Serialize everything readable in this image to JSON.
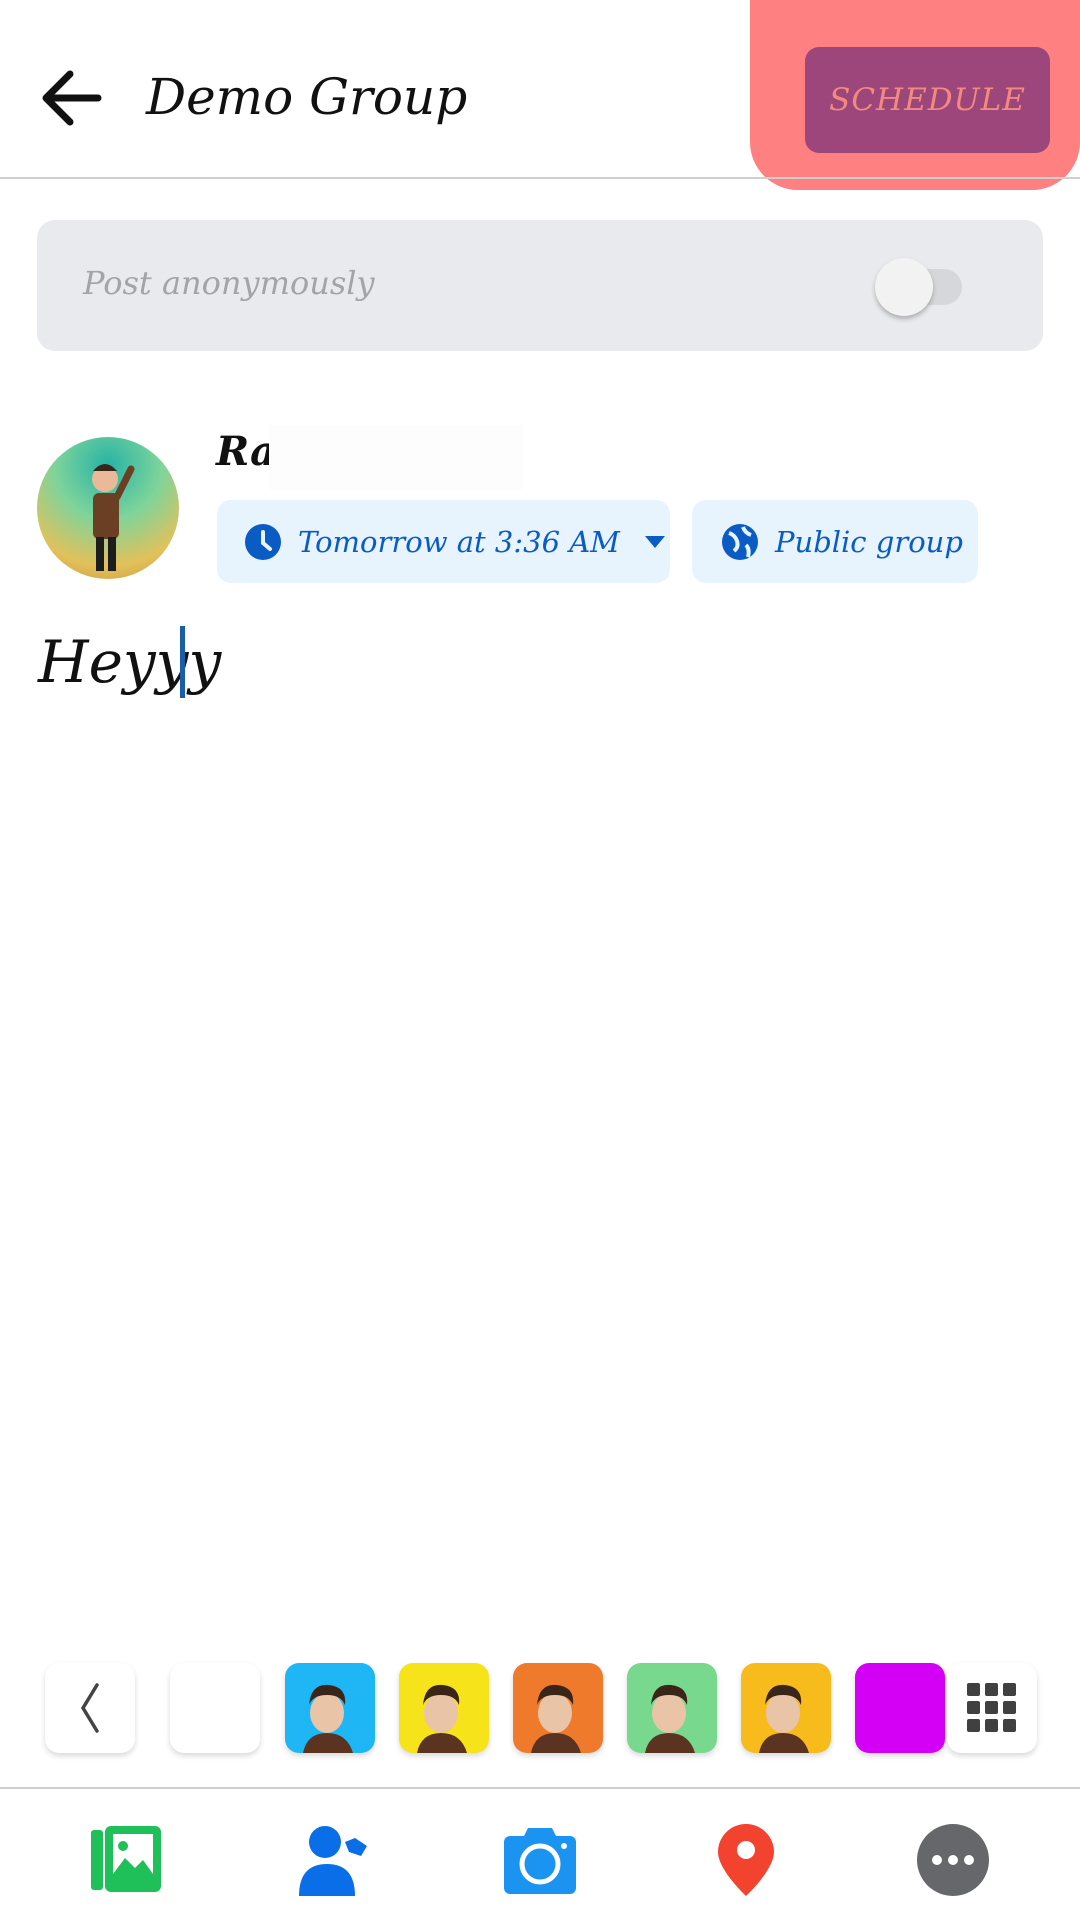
{
  "header": {
    "title": "Demo Group",
    "back_icon": "arrow-left-icon",
    "schedule_label": "SCHEDULE",
    "schedule_bg": "#9c467c",
    "schedule_text_color": "#f28a7e",
    "highlight_color": "#ff8080"
  },
  "anonymous": {
    "label": "Post anonymously",
    "enabled": false
  },
  "author": {
    "name": "Ra",
    "schedule_chip": {
      "label": "Tomorrow at 3:36 AM",
      "icon": "clock-icon",
      "dropdown_icon": "caret-down-icon"
    },
    "audience_chip": {
      "label": "Public group",
      "icon": "globe-icon"
    }
  },
  "composer": {
    "text": "Heyyy"
  },
  "backgrounds": {
    "items": [
      {
        "name": "plain-white",
        "color": "#ffffff"
      },
      {
        "name": "balloon-avatar",
        "color": "#1fb6f5"
      },
      {
        "name": "party-horn-avatar",
        "color": "#f7e31a"
      },
      {
        "name": "basketball-avatar",
        "color": "#f07a2c"
      },
      {
        "name": "flower-avatar",
        "color": "#78d98e"
      },
      {
        "name": "stars-avatar",
        "color": "#f7bb1c"
      },
      {
        "name": "solid-magenta",
        "color": "#d400f5"
      }
    ]
  },
  "toolbar": {
    "items": [
      {
        "name": "photo-video",
        "icon": "photo-gallery-icon",
        "color": "#1fbf5a"
      },
      {
        "name": "tag-people",
        "icon": "tag-person-icon",
        "color": "#0a6ee8"
      },
      {
        "name": "camera",
        "icon": "camera-icon",
        "color": "#1a94f0"
      },
      {
        "name": "check-in",
        "icon": "location-pin-icon",
        "color": "#f2432f"
      },
      {
        "name": "more",
        "icon": "more-dots-icon",
        "color": "#65676b"
      }
    ]
  }
}
